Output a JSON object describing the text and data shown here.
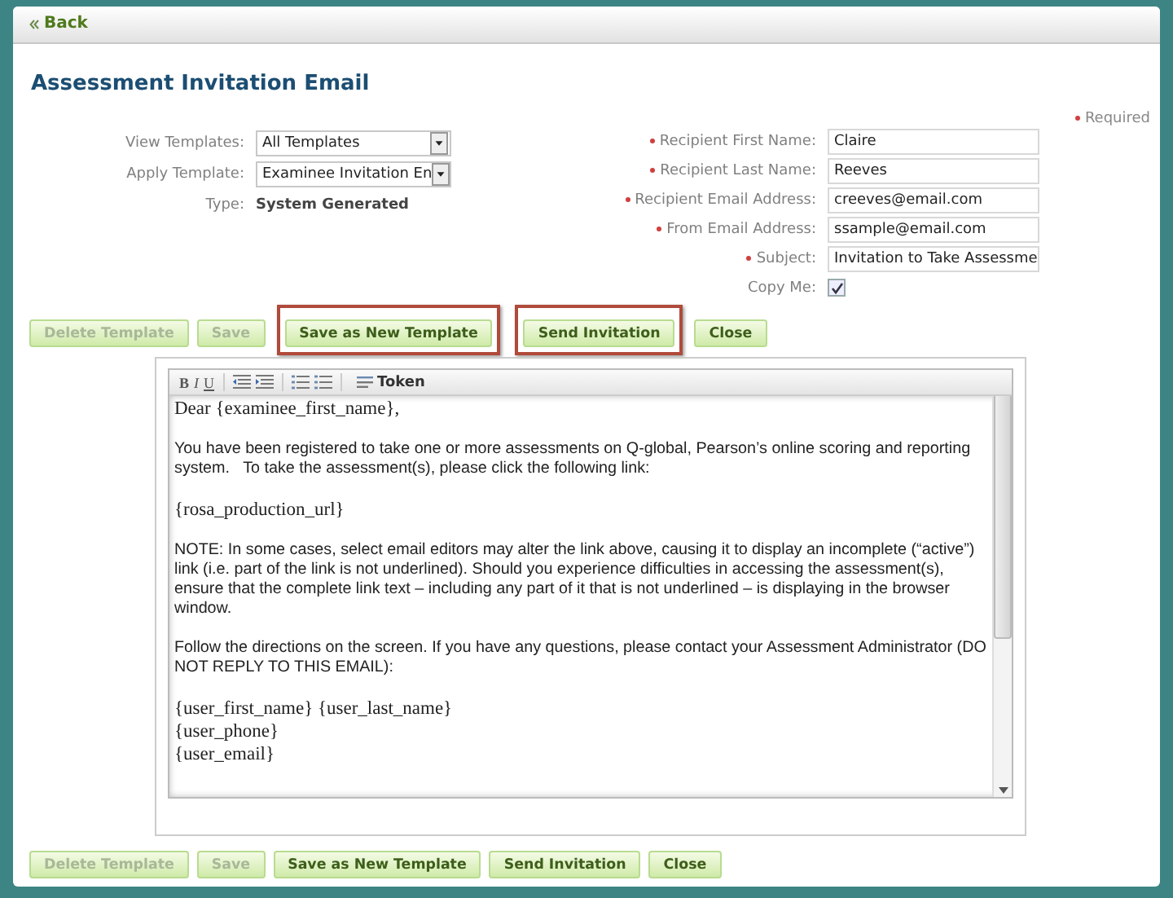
{
  "back_link": {
    "label": "Back"
  },
  "title": "Assessment Invitation Email",
  "required_note": "Required",
  "template_fields": [
    {
      "kind": "select",
      "label": "View Templates:",
      "value": "All Templates"
    },
    {
      "kind": "select",
      "label": "Apply Template:",
      "value": "Examinee Invitation En"
    },
    {
      "kind": "static",
      "label": "Type:",
      "value": "System Generated"
    }
  ],
  "recipient_fields": [
    {
      "kind": "input",
      "label": "Recipient First Name:",
      "required": true,
      "value": "Claire"
    },
    {
      "kind": "input",
      "label": "Recipient Last Name:",
      "required": true,
      "value": "Reeves"
    },
    {
      "kind": "input",
      "label": "Recipient Email Address:",
      "required": true,
      "value": "creeves@email.com"
    },
    {
      "kind": "input",
      "label": "From Email Address:",
      "required": true,
      "value": "ssample@email.com"
    },
    {
      "kind": "input",
      "label": "Subject:",
      "required": true,
      "value": "Invitation to Take Assessme"
    },
    {
      "kind": "checkbox",
      "label": "Copy Me:",
      "required": false,
      "checked": true
    }
  ],
  "top_buttons": [
    {
      "label": "Delete Template",
      "disabled": true,
      "highlighted": false
    },
    {
      "label": "Save",
      "disabled": true,
      "highlighted": false
    },
    {
      "label": "Save as New Template",
      "disabled": false,
      "highlighted": true
    },
    {
      "label": "Send Invitation",
      "disabled": false,
      "highlighted": true
    },
    {
      "label": "Close",
      "disabled": false,
      "highlighted": false
    }
  ],
  "editor": {
    "toolbar": [
      {
        "kind": "bold",
        "label": "B"
      },
      {
        "kind": "italic",
        "label": "I"
      },
      {
        "kind": "underline",
        "label": "U"
      },
      {
        "kind": "outdent"
      },
      {
        "kind": "indent"
      },
      {
        "kind": "numbered-list"
      },
      {
        "kind": "bullet-list"
      },
      {
        "kind": "token",
        "label": "Token"
      }
    ],
    "body": [
      {
        "kind": "mixed",
        "lines": [
          "Dear {examinee_first_name},"
        ]
      },
      {
        "kind": "text",
        "text": "You have been registered to take one or more assessments on Q-global, Pearson’s online scoring and reporting system.   To take the assessment(s), please click the following link:"
      },
      {
        "kind": "token",
        "lines": [
          "{rosa_production_url}"
        ]
      },
      {
        "kind": "text",
        "text": "NOTE: In some cases, select email editors may alter the link above, causing it to display an incomplete (“active”) link (i.e. part of the link is not underlined). Should you experience difficulties in accessing the assessment(s), ensure that the complete link text – including any part of it that is not underlined – is displaying in the browser window."
      },
      {
        "kind": "text",
        "text": "Follow the directions on the screen. If you have any questions, please contact your Assessment Administrator (DO NOT REPLY TO THIS EMAIL):"
      },
      {
        "kind": "token",
        "lines": [
          "{user_first_name} {user_last_name}",
          "{user_phone}",
          "{user_email}"
        ]
      }
    ]
  },
  "bottom_buttons": [
    {
      "label": "Delete Template",
      "disabled": true,
      "highlighted": false
    },
    {
      "label": "Save",
      "disabled": true,
      "highlighted": false
    },
    {
      "label": "Save as New Template",
      "disabled": false,
      "highlighted": false
    },
    {
      "label": "Send Invitation",
      "disabled": false,
      "highlighted": false
    },
    {
      "label": "Close",
      "disabled": false,
      "highlighted": false
    }
  ]
}
